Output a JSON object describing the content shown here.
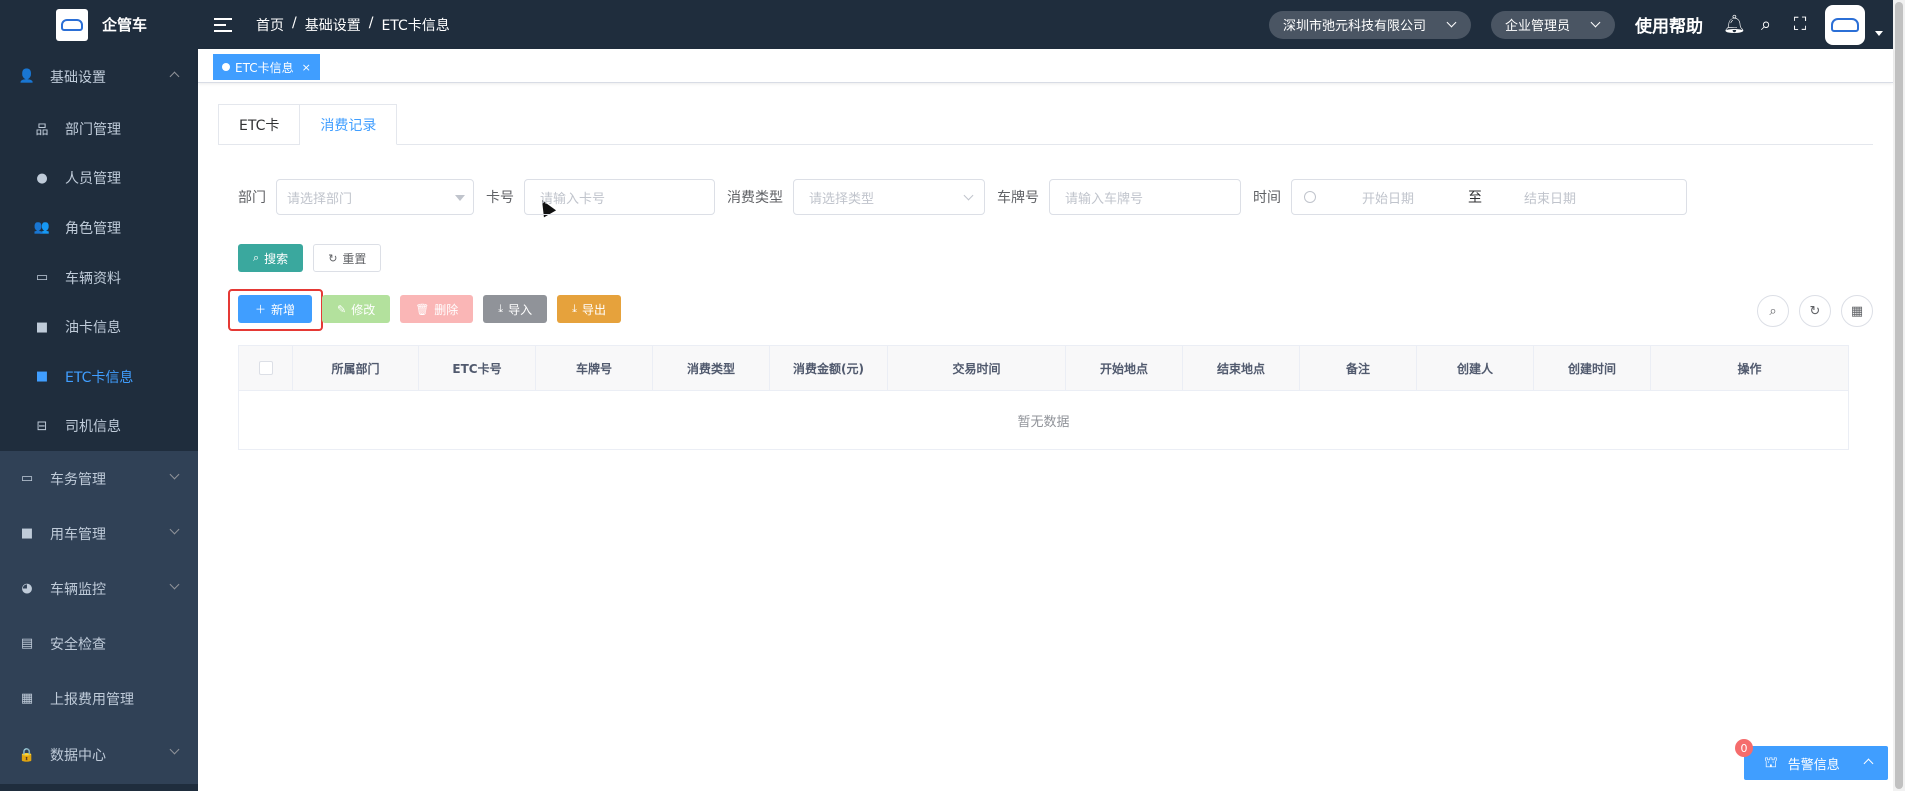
{
  "app": {
    "name": "企管车"
  },
  "sidebar": {
    "groups": [
      {
        "label": "基础设置",
        "icon": "users-icon",
        "open": true,
        "items": [
          {
            "label": "部门管理",
            "icon": "org-tree-icon"
          },
          {
            "label": "人员管理",
            "icon": "user-icon"
          },
          {
            "label": "角色管理",
            "icon": "users-icon"
          },
          {
            "label": "车辆资料",
            "icon": "monitor-icon"
          },
          {
            "label": "油卡信息",
            "icon": "fuel-card-icon"
          },
          {
            "label": "ETC卡信息",
            "icon": "etc-card-icon",
            "active": true
          },
          {
            "label": "司机信息",
            "icon": "car-icon"
          }
        ]
      },
      {
        "label": "车务管理",
        "icon": "monitor-icon"
      },
      {
        "label": "用车管理",
        "icon": "fuel-card-icon"
      },
      {
        "label": "车辆监控",
        "icon": "globe-icon"
      },
      {
        "label": "安全检查",
        "icon": "calendar-icon"
      },
      {
        "label": "上报费用管理",
        "icon": "grid-icon"
      },
      {
        "label": "数据中心",
        "icon": "lock-icon"
      }
    ]
  },
  "header": {
    "breadcrumb": [
      "首页",
      "基础设置",
      "ETC卡信息"
    ],
    "breadcrumb_sep": "/",
    "company": "深圳市弛元科技有限公司",
    "role": "企业管理员",
    "help": "使用帮助"
  },
  "tags": {
    "active": "ETC卡信息",
    "close": "×"
  },
  "tabs": [
    {
      "label": "ETC卡"
    },
    {
      "label": "消费记录",
      "active": true
    }
  ],
  "filters": {
    "dept_label": "部门",
    "dept_placeholder": "请选择部门",
    "card_label": "卡号",
    "card_placeholder": "请输入卡号",
    "type_label": "消费类型",
    "type_placeholder": "请选择类型",
    "plate_label": "车牌号",
    "plate_placeholder": "请输入车牌号",
    "time_label": "时间",
    "start_placeholder": "开始日期",
    "to": "至",
    "end_placeholder": "结束日期"
  },
  "buttons": {
    "search": "搜索",
    "reset": "重置",
    "add": "新增",
    "edit": "修改",
    "delete": "删除",
    "import": "导入",
    "export": "导出"
  },
  "table": {
    "columns": [
      "所属部门",
      "ETC卡号",
      "车牌号",
      "消费类型",
      "消费金额(元)",
      "交易时间",
      "开始地点",
      "结束地点",
      "备注",
      "创建人",
      "创建时间",
      "操作"
    ],
    "empty": "暂无数据"
  },
  "alarm": {
    "label": "告警信息",
    "count": "0"
  },
  "colors": {
    "primary": "#409eff",
    "sidebar": "#1f2d3d",
    "highlight": "#e53935"
  }
}
